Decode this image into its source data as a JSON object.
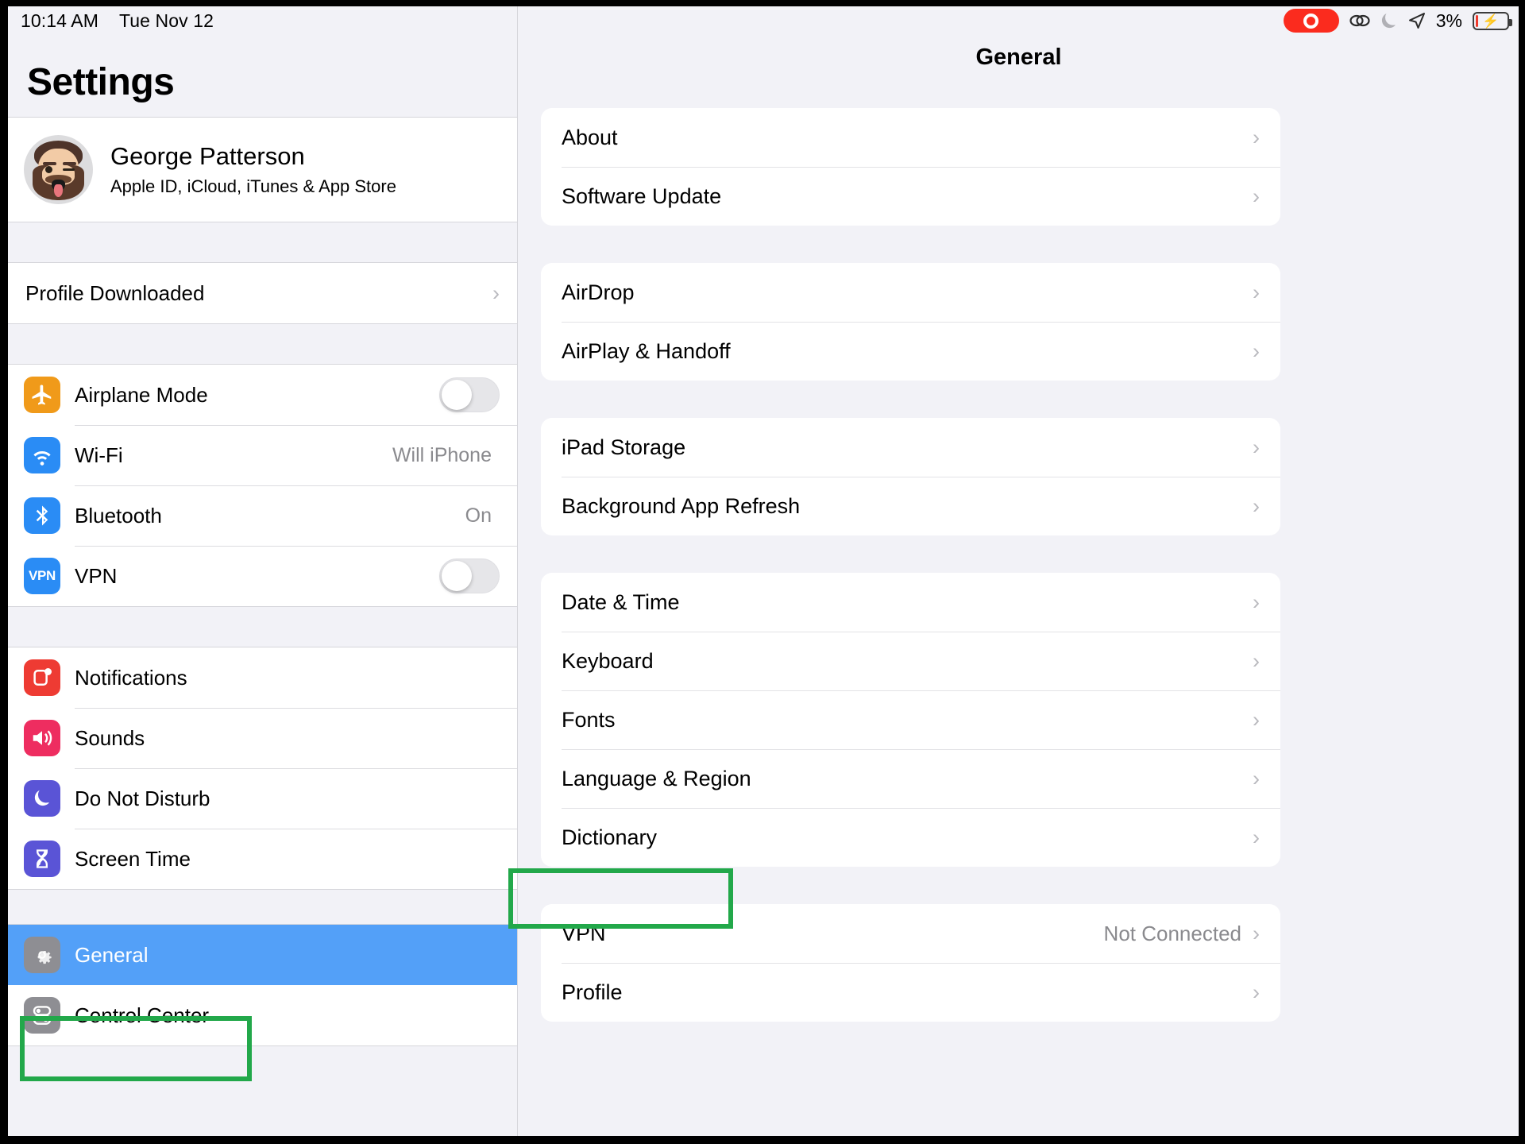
{
  "status_bar": {
    "time": "10:14 AM",
    "date": "Tue Nov 12",
    "battery_percent": "3%",
    "icons": [
      "screen-recording-indicator",
      "link-icon",
      "moon-icon",
      "location-arrow-icon",
      "battery-charging-icon"
    ],
    "accent_recording": "#FB2B1E"
  },
  "sidebar": {
    "title": "Settings",
    "account": {
      "name": "George Patterson",
      "subtitle": "Apple ID, iCloud, iTunes & App Store",
      "avatar": "memoji-avatar"
    },
    "profile_row": {
      "label": "Profile Downloaded",
      "chevron": "›"
    },
    "connectivity": [
      {
        "label": "Airplane Mode",
        "icon": "airplane-icon",
        "icon_color": "#F09A1A",
        "control": "toggle",
        "toggle_on": false
      },
      {
        "label": "Wi-Fi",
        "icon": "wifi-icon",
        "icon_color": "#2A8CF5",
        "control": "value",
        "value": "Will iPhone"
      },
      {
        "label": "Bluetooth",
        "icon": "bluetooth-icon",
        "icon_color": "#2A8CF5",
        "control": "value",
        "value": "On"
      },
      {
        "label": "VPN",
        "icon": "vpn-icon",
        "icon_color": "#2A8CF5",
        "control": "toggle",
        "toggle_on": false
      }
    ],
    "system": [
      {
        "label": "Notifications",
        "icon": "notifications-icon",
        "icon_color": "#EE3B33"
      },
      {
        "label": "Sounds",
        "icon": "sounds-icon",
        "icon_color": "#ED २"
      },
      {
        "label": "Do Not Disturb",
        "icon": "moon-icon",
        "icon_color": "#5A54D6"
      },
      {
        "label": "Screen Time",
        "icon": "hourglass-icon",
        "icon_color": "#5A54D6"
      }
    ],
    "general_group": [
      {
        "label": "General",
        "icon": "gear-icon",
        "icon_color": "#8E8E93",
        "selected": true
      },
      {
        "label": "Control Center",
        "icon": "control-center-icon",
        "icon_color": "#8E8E93",
        "selected": false
      }
    ],
    "selected_bg": "#53A0F8"
  },
  "detail": {
    "title": "General",
    "groups": [
      {
        "rows": [
          {
            "label": "About",
            "value": "",
            "chevron": "›"
          },
          {
            "label": "Software Update",
            "value": "",
            "chevron": "›"
          }
        ]
      },
      {
        "rows": [
          {
            "label": "AirDrop",
            "value": "",
            "chevron": "›"
          },
          {
            "label": "AirPlay & Handoff",
            "value": "",
            "chevron": "›"
          }
        ]
      },
      {
        "rows": [
          {
            "label": "iPad Storage",
            "value": "",
            "chevron": "›"
          },
          {
            "label": "Background App Refresh",
            "value": "",
            "chevron": "›"
          }
        ]
      },
      {
        "rows": [
          {
            "label": "Date & Time",
            "value": "",
            "chevron": "›"
          },
          {
            "label": "Keyboard",
            "value": "",
            "chevron": "›"
          },
          {
            "label": "Fonts",
            "value": "",
            "chevron": "›"
          },
          {
            "label": "Language & Region",
            "value": "",
            "chevron": "›"
          },
          {
            "label": "Dictionary",
            "value": "",
            "chevron": "›"
          }
        ]
      },
      {
        "rows": [
          {
            "label": "VPN",
            "value": "Not Connected",
            "chevron": "›"
          },
          {
            "label": "Profile",
            "value": "",
            "chevron": "›"
          }
        ]
      }
    ]
  },
  "annotations": {
    "color": "#22A84A",
    "boxes": [
      {
        "target": "sidebar-item-general"
      },
      {
        "target": "detail-row-profile"
      }
    ]
  }
}
